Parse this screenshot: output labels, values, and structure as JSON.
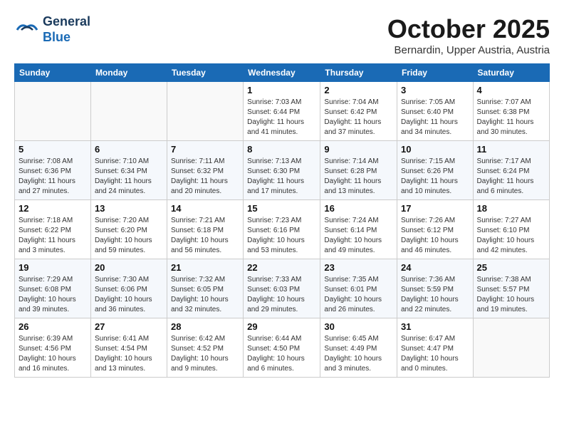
{
  "header": {
    "logo": {
      "line1": "General",
      "line2": "Blue"
    },
    "title": "October 2025",
    "subtitle": "Bernardin, Upper Austria, Austria"
  },
  "weekdays": [
    "Sunday",
    "Monday",
    "Tuesday",
    "Wednesday",
    "Thursday",
    "Friday",
    "Saturday"
  ],
  "weeks": [
    [
      {
        "day": null
      },
      {
        "day": null
      },
      {
        "day": null
      },
      {
        "day": 1,
        "sunrise": "7:03 AM",
        "sunset": "6:44 PM",
        "daylight": "11 hours and 41 minutes."
      },
      {
        "day": 2,
        "sunrise": "7:04 AM",
        "sunset": "6:42 PM",
        "daylight": "11 hours and 37 minutes."
      },
      {
        "day": 3,
        "sunrise": "7:05 AM",
        "sunset": "6:40 PM",
        "daylight": "11 hours and 34 minutes."
      },
      {
        "day": 4,
        "sunrise": "7:07 AM",
        "sunset": "6:38 PM",
        "daylight": "11 hours and 30 minutes."
      }
    ],
    [
      {
        "day": 5,
        "sunrise": "7:08 AM",
        "sunset": "6:36 PM",
        "daylight": "11 hours and 27 minutes."
      },
      {
        "day": 6,
        "sunrise": "7:10 AM",
        "sunset": "6:34 PM",
        "daylight": "11 hours and 24 minutes."
      },
      {
        "day": 7,
        "sunrise": "7:11 AM",
        "sunset": "6:32 PM",
        "daylight": "11 hours and 20 minutes."
      },
      {
        "day": 8,
        "sunrise": "7:13 AM",
        "sunset": "6:30 PM",
        "daylight": "11 hours and 17 minutes."
      },
      {
        "day": 9,
        "sunrise": "7:14 AM",
        "sunset": "6:28 PM",
        "daylight": "11 hours and 13 minutes."
      },
      {
        "day": 10,
        "sunrise": "7:15 AM",
        "sunset": "6:26 PM",
        "daylight": "11 hours and 10 minutes."
      },
      {
        "day": 11,
        "sunrise": "7:17 AM",
        "sunset": "6:24 PM",
        "daylight": "11 hours and 6 minutes."
      }
    ],
    [
      {
        "day": 12,
        "sunrise": "7:18 AM",
        "sunset": "6:22 PM",
        "daylight": "11 hours and 3 minutes."
      },
      {
        "day": 13,
        "sunrise": "7:20 AM",
        "sunset": "6:20 PM",
        "daylight": "10 hours and 59 minutes."
      },
      {
        "day": 14,
        "sunrise": "7:21 AM",
        "sunset": "6:18 PM",
        "daylight": "10 hours and 56 minutes."
      },
      {
        "day": 15,
        "sunrise": "7:23 AM",
        "sunset": "6:16 PM",
        "daylight": "10 hours and 53 minutes."
      },
      {
        "day": 16,
        "sunrise": "7:24 AM",
        "sunset": "6:14 PM",
        "daylight": "10 hours and 49 minutes."
      },
      {
        "day": 17,
        "sunrise": "7:26 AM",
        "sunset": "6:12 PM",
        "daylight": "10 hours and 46 minutes."
      },
      {
        "day": 18,
        "sunrise": "7:27 AM",
        "sunset": "6:10 PM",
        "daylight": "10 hours and 42 minutes."
      }
    ],
    [
      {
        "day": 19,
        "sunrise": "7:29 AM",
        "sunset": "6:08 PM",
        "daylight": "10 hours and 39 minutes."
      },
      {
        "day": 20,
        "sunrise": "7:30 AM",
        "sunset": "6:06 PM",
        "daylight": "10 hours and 36 minutes."
      },
      {
        "day": 21,
        "sunrise": "7:32 AM",
        "sunset": "6:05 PM",
        "daylight": "10 hours and 32 minutes."
      },
      {
        "day": 22,
        "sunrise": "7:33 AM",
        "sunset": "6:03 PM",
        "daylight": "10 hours and 29 minutes."
      },
      {
        "day": 23,
        "sunrise": "7:35 AM",
        "sunset": "6:01 PM",
        "daylight": "10 hours and 26 minutes."
      },
      {
        "day": 24,
        "sunrise": "7:36 AM",
        "sunset": "5:59 PM",
        "daylight": "10 hours and 22 minutes."
      },
      {
        "day": 25,
        "sunrise": "7:38 AM",
        "sunset": "5:57 PM",
        "daylight": "10 hours and 19 minutes."
      }
    ],
    [
      {
        "day": 26,
        "sunrise": "6:39 AM",
        "sunset": "4:56 PM",
        "daylight": "10 hours and 16 minutes."
      },
      {
        "day": 27,
        "sunrise": "6:41 AM",
        "sunset": "4:54 PM",
        "daylight": "10 hours and 13 minutes."
      },
      {
        "day": 28,
        "sunrise": "6:42 AM",
        "sunset": "4:52 PM",
        "daylight": "10 hours and 9 minutes."
      },
      {
        "day": 29,
        "sunrise": "6:44 AM",
        "sunset": "4:50 PM",
        "daylight": "10 hours and 6 minutes."
      },
      {
        "day": 30,
        "sunrise": "6:45 AM",
        "sunset": "4:49 PM",
        "daylight": "10 hours and 3 minutes."
      },
      {
        "day": 31,
        "sunrise": "6:47 AM",
        "sunset": "4:47 PM",
        "daylight": "10 hours and 0 minutes."
      },
      {
        "day": null
      }
    ]
  ],
  "daylight_label": "Daylight hours",
  "sunrise_label": "Sunrise:",
  "sunset_label": "Sunset:"
}
